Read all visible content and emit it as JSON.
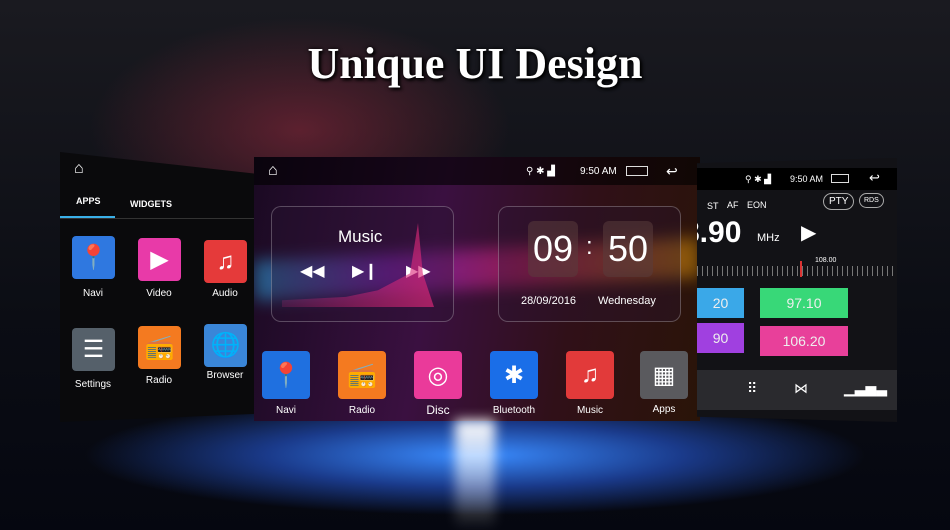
{
  "title": "Unique UI Design",
  "left_screen": {
    "tabs": [
      "APPS",
      "WIDGETS"
    ],
    "apps": [
      {
        "label": "Navi",
        "icon": "map-pin-icon",
        "color": "#2f78e0"
      },
      {
        "label": "Video",
        "icon": "video-play-icon",
        "color": "#e83aa8"
      },
      {
        "label": "Audio",
        "icon": "music-note-icon",
        "color": "#e53a3a"
      },
      {
        "label": "Settings",
        "icon": "sliders-icon",
        "color": "#55606a"
      },
      {
        "label": "Radio",
        "icon": "radio-icon",
        "color": "#f47a20"
      },
      {
        "label": "Browser",
        "icon": "globe-icon",
        "color": "#3a86d8"
      }
    ]
  },
  "center_screen": {
    "status": {
      "time": "9:50 AM"
    },
    "music_widget": {
      "title": "Music"
    },
    "clock_widget": {
      "hour": "09",
      "separator": ":",
      "minute": "50",
      "date": "28/09/2016",
      "weekday": "Wednesday"
    },
    "dock": [
      {
        "label": "Navi",
        "icon": "map-pin-icon",
        "color": "#1f70e0"
      },
      {
        "label": "Radio",
        "icon": "radio-icon",
        "color": "#f47a20"
      },
      {
        "label": "Disc",
        "icon": "disc-icon",
        "color": "#ea3a9a"
      },
      {
        "label": "Bluetooth",
        "icon": "bluetooth-icon",
        "color": "#1a6ee8"
      },
      {
        "label": "Music",
        "icon": "music-note-icon",
        "color": "#e23a3a"
      },
      {
        "label": "Apps",
        "icon": "grid-icon",
        "color": "#5a5a5e"
      }
    ]
  },
  "right_screen": {
    "status": {
      "time": "9:50 AM"
    },
    "flags": [
      "ST",
      "AF",
      "EON"
    ],
    "pty_label": "PTY",
    "rds_label": "RDS",
    "frequency": "8.90",
    "unit": "MHz",
    "scale_label": "108.00",
    "presets": [
      {
        "label": "20",
        "color": "#3aa8e8"
      },
      {
        "label": "97.10",
        "color": "#38d878"
      },
      {
        "label": "90",
        "color": "#a040e0"
      },
      {
        "label": "106.20",
        "color": "#e8409a"
      }
    ]
  }
}
